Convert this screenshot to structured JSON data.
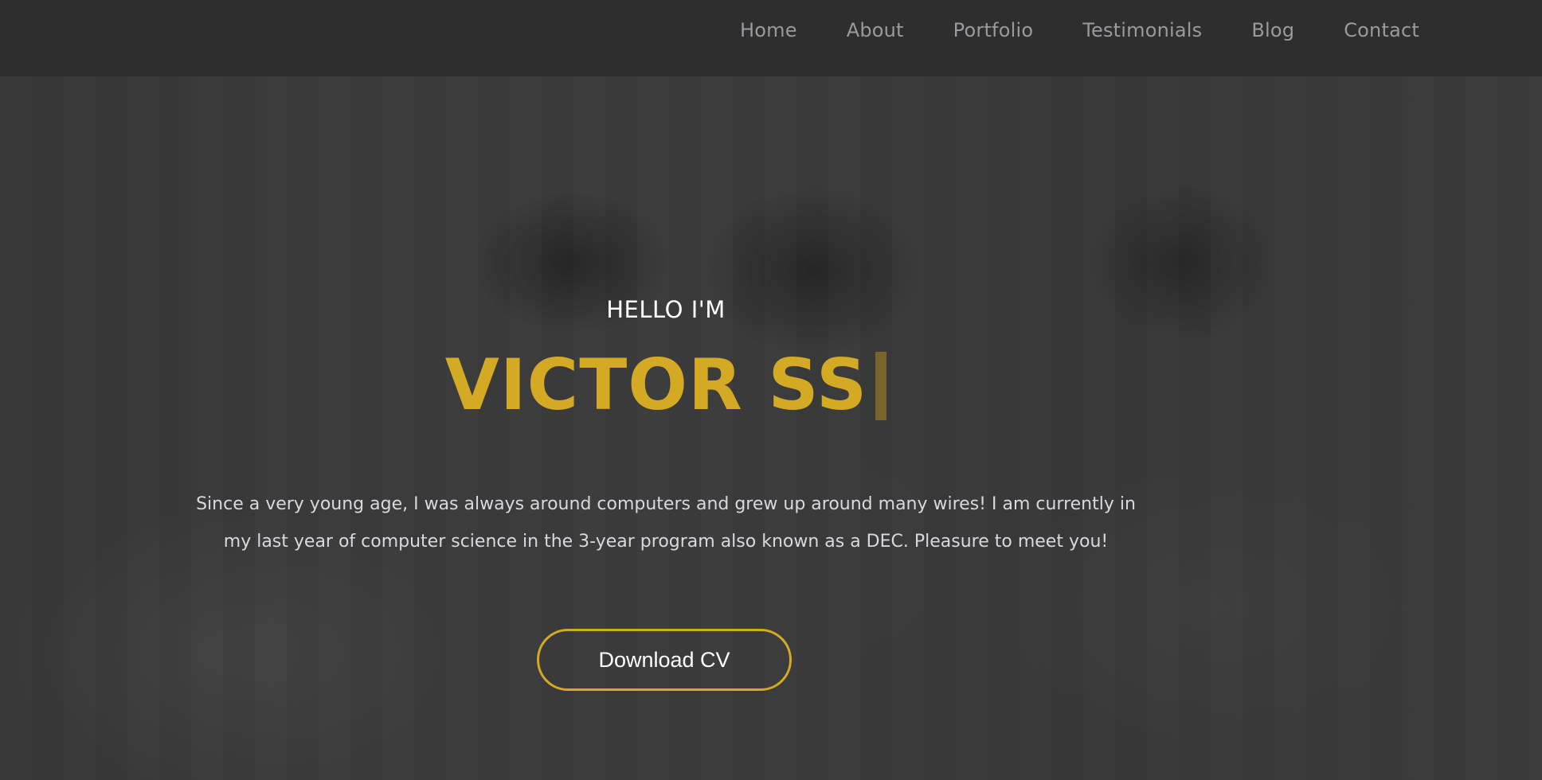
{
  "nav": {
    "items": [
      {
        "label": "Home"
      },
      {
        "label": "About"
      },
      {
        "label": "Portfolio"
      },
      {
        "label": "Testimonials"
      },
      {
        "label": "Blog"
      },
      {
        "label": "Contact"
      }
    ]
  },
  "hero": {
    "greeting": "HELLO I'M",
    "name": "VICTOR SS",
    "bio": "Since a very young age, I was always around computers and grew up around many wires! I am currently in my last year of computer science in the 3-year program also known as a DEC. Pleasure to meet you!",
    "cv_button_label": "Download CV"
  },
  "colors": {
    "accent": "#d4a923",
    "nav_background": "#2e2e2e",
    "nav_text": "#9a9a9e",
    "hero_text": "#ffffff",
    "bio_text": "#d8d8de"
  }
}
